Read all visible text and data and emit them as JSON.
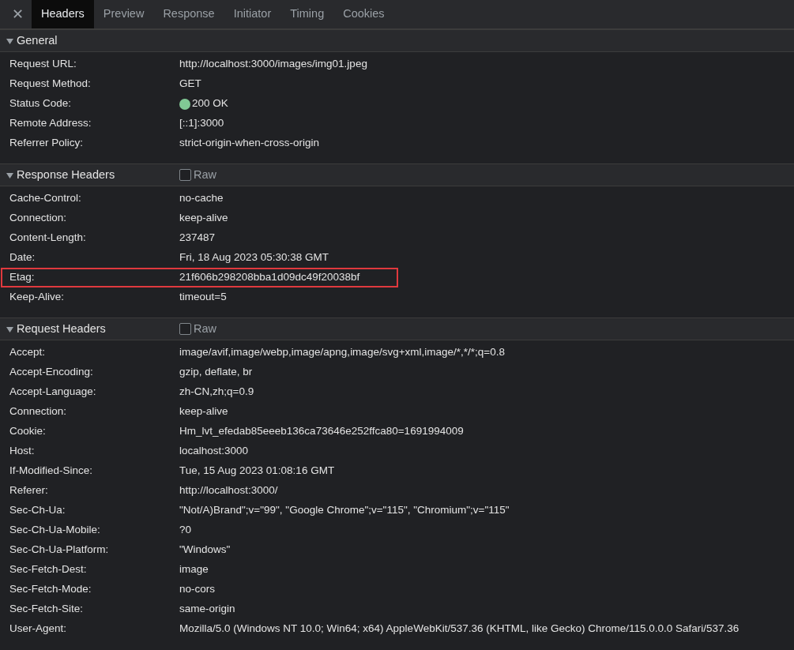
{
  "close_label": "✕",
  "tabs": [
    {
      "label": "Headers",
      "selected": true
    },
    {
      "label": "Preview",
      "selected": false
    },
    {
      "label": "Response",
      "selected": false
    },
    {
      "label": "Initiator",
      "selected": false
    },
    {
      "label": "Timing",
      "selected": false
    },
    {
      "label": "Cookies",
      "selected": false
    }
  ],
  "sections": [
    {
      "title": "General",
      "expanded": true,
      "rows": [
        {
          "name": "Request URL:",
          "value": "http://localhost:3000/images/img01.jpeg"
        },
        {
          "name": "Request Method:",
          "value": "GET"
        },
        {
          "name": "Status Code:",
          "value": "200 OK",
          "color": "#81c995"
        },
        {
          "name": "Remote Address:",
          "value": "[::1]:3000"
        },
        {
          "name": "Referrer Policy:",
          "value": "strict-origin-when-cross-origin"
        }
      ]
    },
    {
      "title": "Response Headers",
      "expanded": true,
      "raw": {
        "label": "Raw",
        "checked": false
      },
      "rows": [
        {
          "name": "Cache-Control:",
          "value": "no-cache",
          "highlighted": false
        },
        {
          "name": "Connection:",
          "value": "keep-alive",
          "highlighted": false
        },
        {
          "name": "Content-Length:",
          "value": "237487",
          "highlighted": false
        },
        {
          "name": "Date:",
          "value": "Fri, 18 Aug 2023 05:30:38 GMT",
          "highlighted": false
        },
        {
          "name": "Etag:",
          "value": "21f606b298208bba1d09dc49f20038bf",
          "highlighted": true
        },
        {
          "name": "Keep-Alive:",
          "value": "timeout=5",
          "highlighted": false
        }
      ]
    },
    {
      "title": "Request Headers",
      "expanded": true,
      "raw": {
        "label": "Raw",
        "checked": false
      },
      "rows": [
        {
          "name": "Accept:",
          "value": "image/avif,image/webp,image/apng,image/svg+xml,image/*,*/*;q=0.8"
        },
        {
          "name": "Accept-Encoding:",
          "value": "gzip, deflate, br"
        },
        {
          "name": "Accept-Language:",
          "value": "zh-CN,zh;q=0.9"
        },
        {
          "name": "Connection:",
          "value": "keep-alive"
        },
        {
          "name": "Cookie:",
          "value": "Hm_lvt_efedab85eeeb136ca73646e252ffca80=1691994009"
        },
        {
          "name": "Host:",
          "value": "localhost:3000"
        },
        {
          "name": "If-Modified-Since:",
          "value": "Tue, 15 Aug 2023 01:08:16 GMT"
        },
        {
          "name": "Referer:",
          "value": "http://localhost:3000/"
        },
        {
          "name": "Sec-Ch-Ua:",
          "value": "\"Not/A)Brand\";v=\"99\", \"Google Chrome\";v=\"115\", \"Chromium\";v=\"115\""
        },
        {
          "name": "Sec-Ch-Ua-Mobile:",
          "value": "?0"
        },
        {
          "name": "Sec-Ch-Ua-Platform:",
          "value": "\"Windows\""
        },
        {
          "name": "Sec-Fetch-Dest:",
          "value": "image"
        },
        {
          "name": "Sec-Fetch-Mode:",
          "value": "no-cors"
        },
        {
          "name": "Sec-Fetch-Site:",
          "value": "same-origin"
        },
        {
          "name": "User-Agent:",
          "value": "Mozilla/5.0 (Windows NT 10.0; Win64; x64) AppleWebKit/537.36 (KHTML, like Gecko) Chrome/115.0.0.0 Safari/537.36"
        }
      ]
    }
  ]
}
